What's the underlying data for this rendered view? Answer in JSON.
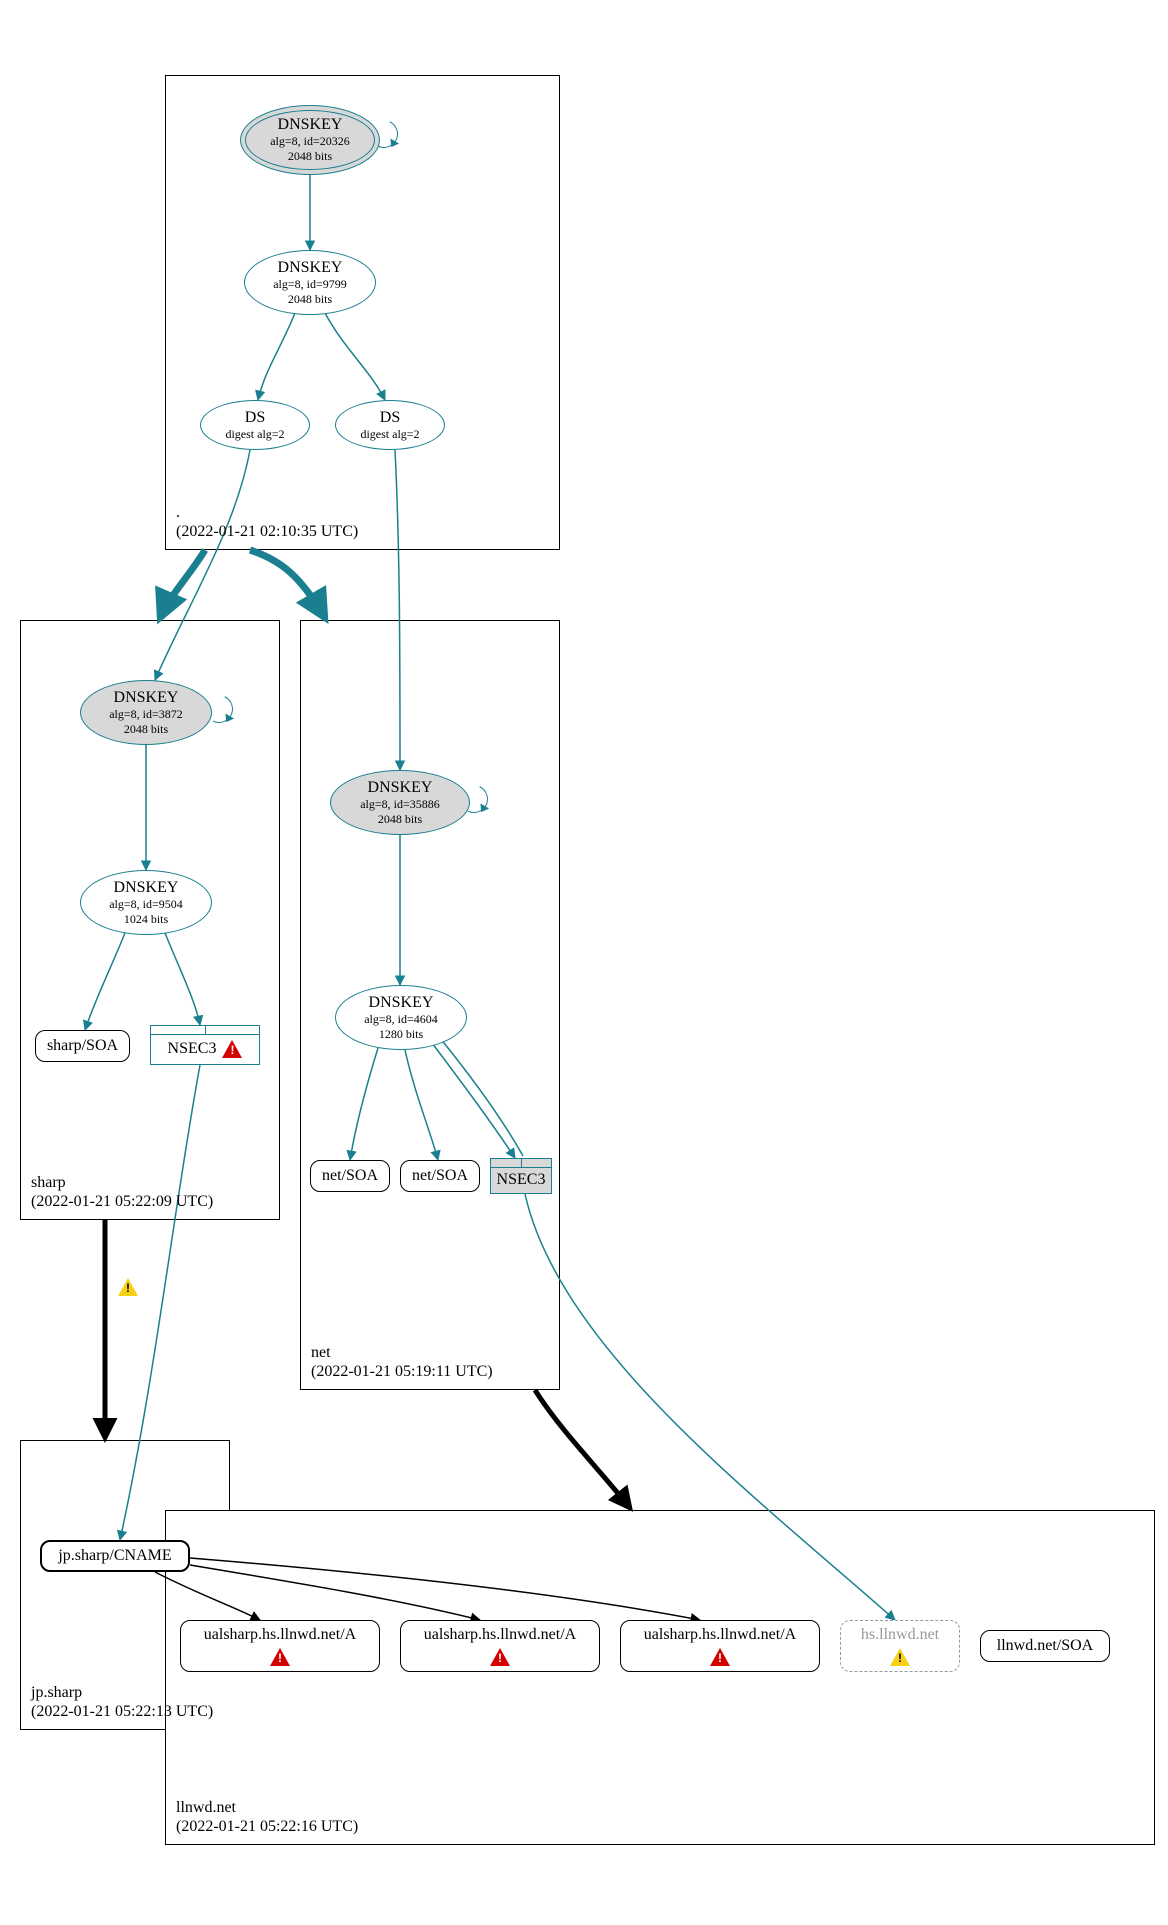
{
  "colors": {
    "teal": "#1a7f8f",
    "grey_fill": "#d8d8d8",
    "black": "#000000",
    "red": "#d40000",
    "yellow": "#f7d117"
  },
  "zones": {
    "root": {
      "name": ".",
      "ts": "(2022-01-21 02:10:35 UTC)"
    },
    "sharp": {
      "name": "sharp",
      "ts": "(2022-01-21 05:22:09 UTC)"
    },
    "net": {
      "name": "net",
      "ts": "(2022-01-21 05:19:11 UTC)"
    },
    "jpsharp": {
      "name": "jp.sharp",
      "ts": "(2022-01-21 05:22:13 UTC)"
    },
    "llnwd": {
      "name": "llnwd.net",
      "ts": "(2022-01-21 05:22:16 UTC)"
    }
  },
  "nodes": {
    "root_ksk": {
      "title": "DNSKEY",
      "sub1": "alg=8, id=20326",
      "sub2": "2048 bits"
    },
    "root_zsk": {
      "title": "DNSKEY",
      "sub1": "alg=8, id=9799",
      "sub2": "2048 bits"
    },
    "ds_left": {
      "title": "DS",
      "sub1": "digest alg=2"
    },
    "ds_right": {
      "title": "DS",
      "sub1": "digest alg=2"
    },
    "sharp_ksk": {
      "title": "DNSKEY",
      "sub1": "alg=8, id=3872",
      "sub2": "2048 bits"
    },
    "sharp_zsk": {
      "title": "DNSKEY",
      "sub1": "alg=8, id=9504",
      "sub2": "1024 bits"
    },
    "sharp_soa": {
      "title": "sharp/SOA"
    },
    "sharp_nsec3": {
      "title": "NSEC3"
    },
    "net_ksk": {
      "title": "DNSKEY",
      "sub1": "alg=8, id=35886",
      "sub2": "2048 bits"
    },
    "net_zsk": {
      "title": "DNSKEY",
      "sub1": "alg=8, id=4604",
      "sub2": "1280 bits"
    },
    "net_soa1": {
      "title": "net/SOA"
    },
    "net_soa2": {
      "title": "net/SOA"
    },
    "net_nsec3": {
      "title": "NSEC3"
    },
    "jp_cname": {
      "title": "jp.sharp/CNAME"
    },
    "ual1": {
      "title": "ualsharp.hs.llnwd.net/A"
    },
    "ual2": {
      "title": "ualsharp.hs.llnwd.net/A"
    },
    "ual3": {
      "title": "ualsharp.hs.llnwd.net/A"
    },
    "hs_llnwd": {
      "title": "hs.llnwd.net"
    },
    "llnwd_soa": {
      "title": "llnwd.net/SOA"
    }
  }
}
